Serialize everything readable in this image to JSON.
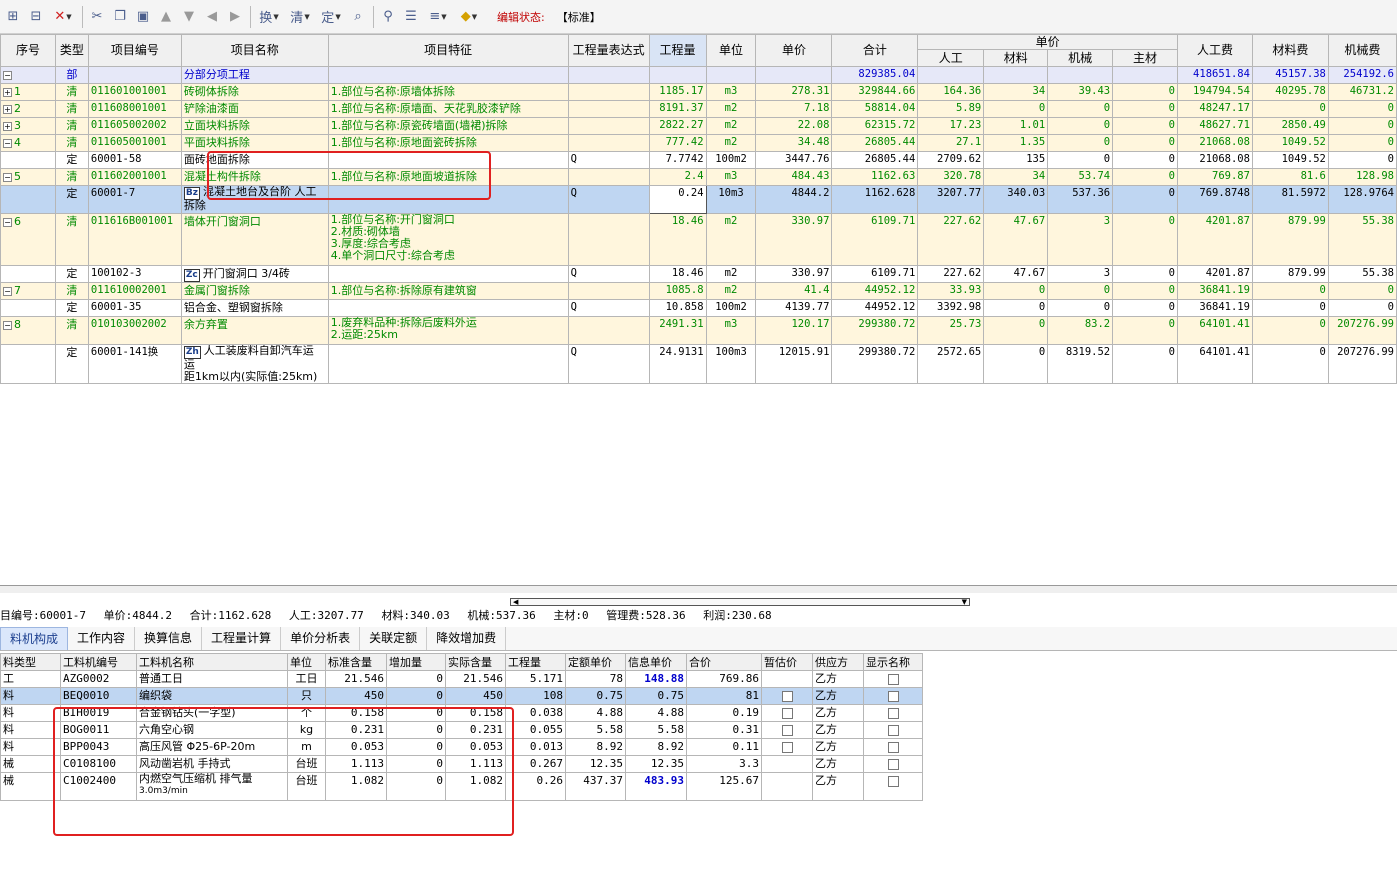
{
  "toolbar": {
    "icons": [
      "insert-row-icon",
      "delete-row-icon",
      "delete-x-icon",
      "cut-icon",
      "copy-icon",
      "paste-icon",
      "move-up-icon",
      "move-down-icon",
      "move-left-icon",
      "move-right-icon",
      "quota-icon",
      "list-icon",
      "define-icon",
      "find-icon",
      "binoculars-icon",
      "expand-icon",
      "level-icon",
      "color-fill-icon"
    ],
    "edit_status_label": "编辑状态:",
    "edit_status_value": "【标准】"
  },
  "main_headers": {
    "seq": "序号",
    "type": "类型",
    "code": "项目编号",
    "name": "项目名称",
    "feature": "项目特征",
    "expr": "工程量表达式",
    "qty": "工程量",
    "unit": "单位",
    "price": "单价",
    "total": "合计",
    "unit_price_group": "单价",
    "labor": "人工",
    "material": "材料",
    "machine": "机械",
    "main_mat": "主材",
    "labor_fee": "人工费",
    "material_fee": "材料费",
    "machine_fee": "机械费"
  },
  "main_rows": [
    {
      "kind": "bu",
      "exp": "-",
      "seq": "",
      "type": "部",
      "code": "",
      "name": "分部分项工程",
      "feature": "",
      "expr": "",
      "qty": "",
      "unit": "",
      "price": "",
      "total": "829385.04",
      "labor": "",
      "material": "",
      "machine": "",
      "main_mat": "",
      "labor_fee": "418651.84",
      "material_fee": "45157.38",
      "machine_fee": "254192.6"
    },
    {
      "kind": "qd",
      "exp": "+",
      "seq": "1",
      "type": "清",
      "code": "011601001001",
      "name": "砖砌体拆除",
      "feature": "1.部位与名称:原墙体拆除",
      "expr": "",
      "qty": "1185.17",
      "unit": "m3",
      "price": "278.31",
      "total": "329844.66",
      "labor": "164.36",
      "material": "34",
      "machine": "39.43",
      "main_mat": "0",
      "labor_fee": "194794.54",
      "material_fee": "40295.78",
      "machine_fee": "46731.2"
    },
    {
      "kind": "qd",
      "exp": "+",
      "seq": "2",
      "type": "清",
      "code": "011608001001",
      "name": "铲除油漆面",
      "feature": "1.部位与名称:原墙面、天花乳胶漆铲除",
      "expr": "",
      "qty": "8191.37",
      "unit": "m2",
      "price": "7.18",
      "total": "58814.04",
      "labor": "5.89",
      "material": "0",
      "machine": "0",
      "main_mat": "0",
      "labor_fee": "48247.17",
      "material_fee": "0",
      "machine_fee": "0"
    },
    {
      "kind": "qd",
      "exp": "+",
      "seq": "3",
      "type": "清",
      "code": "011605002002",
      "name": "立面块料拆除",
      "feature": "1.部位与名称:原瓷砖墙面(墙裙)拆除",
      "expr": "",
      "qty": "2822.27",
      "unit": "m2",
      "price": "22.08",
      "total": "62315.72",
      "labor": "17.23",
      "material": "1.01",
      "machine": "0",
      "main_mat": "0",
      "labor_fee": "48627.71",
      "material_fee": "2850.49",
      "machine_fee": "0"
    },
    {
      "kind": "qd",
      "exp": "-",
      "seq": "4",
      "type": "清",
      "code": "011605001001",
      "name": "平面块料拆除",
      "feature": "1.部位与名称:原地面瓷砖拆除",
      "expr": "",
      "qty": "777.42",
      "unit": "m2",
      "price": "34.48",
      "total": "26805.44",
      "labor": "27.1",
      "material": "1.35",
      "machine": "0",
      "main_mat": "0",
      "labor_fee": "21068.08",
      "material_fee": "1049.52",
      "machine_fee": "0"
    },
    {
      "kind": "de",
      "exp": "",
      "seq": "",
      "type": "定",
      "code": "60001-58",
      "name": "面砖地面拆除",
      "feature": "",
      "expr": "Q",
      "qty": "7.7742",
      "unit": "100m2",
      "price": "3447.76",
      "total": "26805.44",
      "labor": "2709.62",
      "material": "135",
      "machine": "0",
      "main_mat": "0",
      "labor_fee": "21068.08",
      "material_fee": "1049.52",
      "machine_fee": "0"
    },
    {
      "kind": "qd",
      "exp": "-",
      "seq": "5",
      "type": "清",
      "code": "011602001001",
      "name": "混凝土构件拆除",
      "feature": "1.部位与名称:原地面坡道拆除",
      "expr": "",
      "qty": "2.4",
      "unit": "m3",
      "price": "484.43",
      "total": "1162.63",
      "labor": "320.78",
      "material": "34",
      "machine": "53.74",
      "main_mat": "0",
      "labor_fee": "769.87",
      "material_fee": "81.6",
      "machine_fee": "128.98"
    },
    {
      "kind": "sel",
      "exp": "",
      "seq": "",
      "type": "定",
      "code": "60001-7",
      "badge": "Bz",
      "name": "混凝土地台及台阶 人工拆除",
      "feature": "",
      "expr": "Q",
      "qty": "0.24",
      "unit": "10m3",
      "price": "4844.2",
      "total": "1162.628",
      "labor": "3207.77",
      "material": "340.03",
      "machine": "537.36",
      "main_mat": "0",
      "labor_fee": "769.8748",
      "material_fee": "81.5972",
      "machine_fee": "128.9764"
    },
    {
      "kind": "qd",
      "exp": "-",
      "seq": "6",
      "type": "清",
      "code": "011616B001001",
      "name": "墙体开门窗洞口",
      "feature_lines": [
        "1.部位与名称:开门窗洞口",
        "2.材质:砌体墙",
        "3.厚度:综合考虑",
        "4.单个洞口尺寸:综合考虑"
      ],
      "expr": "",
      "qty": "18.46",
      "unit": "m2",
      "price": "330.97",
      "total": "6109.71",
      "labor": "227.62",
      "material": "47.67",
      "machine": "3",
      "main_mat": "0",
      "labor_fee": "4201.87",
      "material_fee": "879.99",
      "machine_fee": "55.38"
    },
    {
      "kind": "de",
      "exp": "",
      "seq": "",
      "type": "定",
      "code": "100102-3",
      "badge": "Zc",
      "name": "开门窗洞口 3/4砖",
      "feature": "",
      "expr": "Q",
      "qty": "18.46",
      "unit": "m2",
      "price": "330.97",
      "total": "6109.71",
      "labor": "227.62",
      "material": "47.67",
      "machine": "3",
      "main_mat": "0",
      "labor_fee": "4201.87",
      "material_fee": "879.99",
      "machine_fee": "55.38"
    },
    {
      "kind": "qd",
      "exp": "-",
      "seq": "7",
      "type": "清",
      "code": "011610002001",
      "name": "金属门窗拆除",
      "feature": "1.部位与名称:拆除原有建筑窗",
      "expr": "",
      "qty": "1085.8",
      "unit": "m2",
      "price": "41.4",
      "total": "44952.12",
      "labor": "33.93",
      "material": "0",
      "machine": "0",
      "main_mat": "0",
      "labor_fee": "36841.19",
      "material_fee": "0",
      "machine_fee": "0"
    },
    {
      "kind": "de",
      "exp": "",
      "seq": "",
      "type": "定",
      "code": "60001-35",
      "name": "铝合金、塑钢窗拆除",
      "feature": "",
      "expr": "Q",
      "qty": "10.858",
      "unit": "100m2",
      "price": "4139.77",
      "total": "44952.12",
      "labor": "3392.98",
      "material": "0",
      "machine": "0",
      "main_mat": "0",
      "labor_fee": "36841.19",
      "material_fee": "0",
      "machine_fee": "0"
    },
    {
      "kind": "qd",
      "exp": "-",
      "seq": "8",
      "type": "清",
      "code": "010103002002",
      "name": "余方弃置",
      "feature_lines": [
        "1.废弃料品种:拆除后废料外运",
        "2.运距:25km"
      ],
      "expr": "",
      "qty": "2491.31",
      "unit": "m3",
      "price": "120.17",
      "total": "299380.72",
      "labor": "25.73",
      "material": "0",
      "machine": "83.2",
      "main_mat": "0",
      "labor_fee": "64101.41",
      "material_fee": "0",
      "machine_fee": "207276.99"
    },
    {
      "kind": "de",
      "exp": "",
      "seq": "",
      "type": "定",
      "code": "60001-141换",
      "badge": "Zh",
      "name_lines": [
        "人工装废料自卸汽车运 运",
        "距1km以内(实际值:25km)"
      ],
      "feature": "",
      "expr": "Q",
      "qty": "24.9131",
      "unit": "100m3",
      "price": "12015.91",
      "total": "299380.72",
      "labor": "2572.65",
      "material": "0",
      "machine": "8319.52",
      "main_mat": "0",
      "labor_fee": "64101.41",
      "material_fee": "0",
      "machine_fee": "207276.99"
    }
  ],
  "status_line": {
    "code": "目编号:60001-7",
    "price": "单价:4844.2",
    "total": "合计:1162.628",
    "labor": "人工:3207.77",
    "material": "材料:340.03",
    "machine": "机械:537.36",
    "main_mat": "主材:0",
    "mgmt": "管理费:528.36",
    "profit": "利润:230.68"
  },
  "tabs": [
    "料机构成",
    "工作内容",
    "换算信息",
    "工程量计算",
    "单价分析表",
    "关联定额",
    "降效增加费"
  ],
  "sub_headers": [
    "料类型",
    "工料机编号",
    "工料机名称",
    "单位",
    "标准含量",
    "增加量",
    "实际含量",
    "工程量",
    "定额单价",
    "信息单价",
    "合价",
    "暂估价",
    "供应方",
    "显示名称"
  ],
  "sub_rows": [
    {
      "type": "工",
      "code": "AZG0002",
      "name": "普通工日",
      "unit": "工日",
      "std": "21.546",
      "add": "0",
      "act": "21.546",
      "qty": "5.171",
      "quota": "78",
      "info": "148.88",
      "info_bold": true,
      "sum": "769.86",
      "est": false,
      "supplier": "乙方",
      "show": true,
      "sel": false
    },
    {
      "type": "料",
      "code": "BEQ0010",
      "name": "编织袋",
      "unit": "只",
      "std": "450",
      "add": "0",
      "act": "450",
      "qty": "108",
      "quota": "0.75",
      "info": "0.75",
      "sum": "81",
      "est": true,
      "supplier": "乙方",
      "show": true,
      "sel": true
    },
    {
      "type": "料",
      "code": "BIH0019",
      "name": "合金钢钻头(一字型)",
      "unit": "个",
      "std": "0.158",
      "add": "0",
      "act": "0.158",
      "qty": "0.038",
      "quota": "4.88",
      "info": "4.88",
      "sum": "0.19",
      "est": true,
      "supplier": "乙方",
      "show": true,
      "sel": false
    },
    {
      "type": "料",
      "code": "BOG0011",
      "name": "六角空心钢",
      "unit": "kg",
      "std": "0.231",
      "add": "0",
      "act": "0.231",
      "qty": "0.055",
      "quota": "5.58",
      "info": "5.58",
      "sum": "0.31",
      "est": true,
      "supplier": "乙方",
      "show": true,
      "sel": false
    },
    {
      "type": "料",
      "code": "BPP0043",
      "name": "高压风管 Φ25-6P-20m",
      "unit": "m",
      "std": "0.053",
      "add": "0",
      "act": "0.053",
      "qty": "0.013",
      "quota": "8.92",
      "info": "8.92",
      "sum": "0.11",
      "est": true,
      "supplier": "乙方",
      "show": true,
      "sel": false
    },
    {
      "type": "械",
      "code": "C0108100",
      "name": "风动凿岩机 手持式",
      "unit": "台班",
      "std": "1.113",
      "add": "0",
      "act": "1.113",
      "qty": "0.267",
      "quota": "12.35",
      "info": "12.35",
      "sum": "3.3",
      "est": false,
      "supplier": "乙方",
      "show": true,
      "sel": false
    },
    {
      "type": "械",
      "code": "C1002400",
      "name_lines": [
        "内燃空气压缩机 排气量",
        "3.0m3/min"
      ],
      "unit": "台班",
      "std": "1.082",
      "add": "0",
      "act": "1.082",
      "qty": "0.26",
      "quota": "437.37",
      "info": "483.93",
      "info_bold": true,
      "sum": "125.67",
      "est": false,
      "supplier": "乙方",
      "show": true,
      "sel": false
    }
  ],
  "colors": {
    "annotation": "#e02020",
    "selected": "#bfd6f2",
    "list_green": "#008a00",
    "part_blue": "#0000cc"
  }
}
